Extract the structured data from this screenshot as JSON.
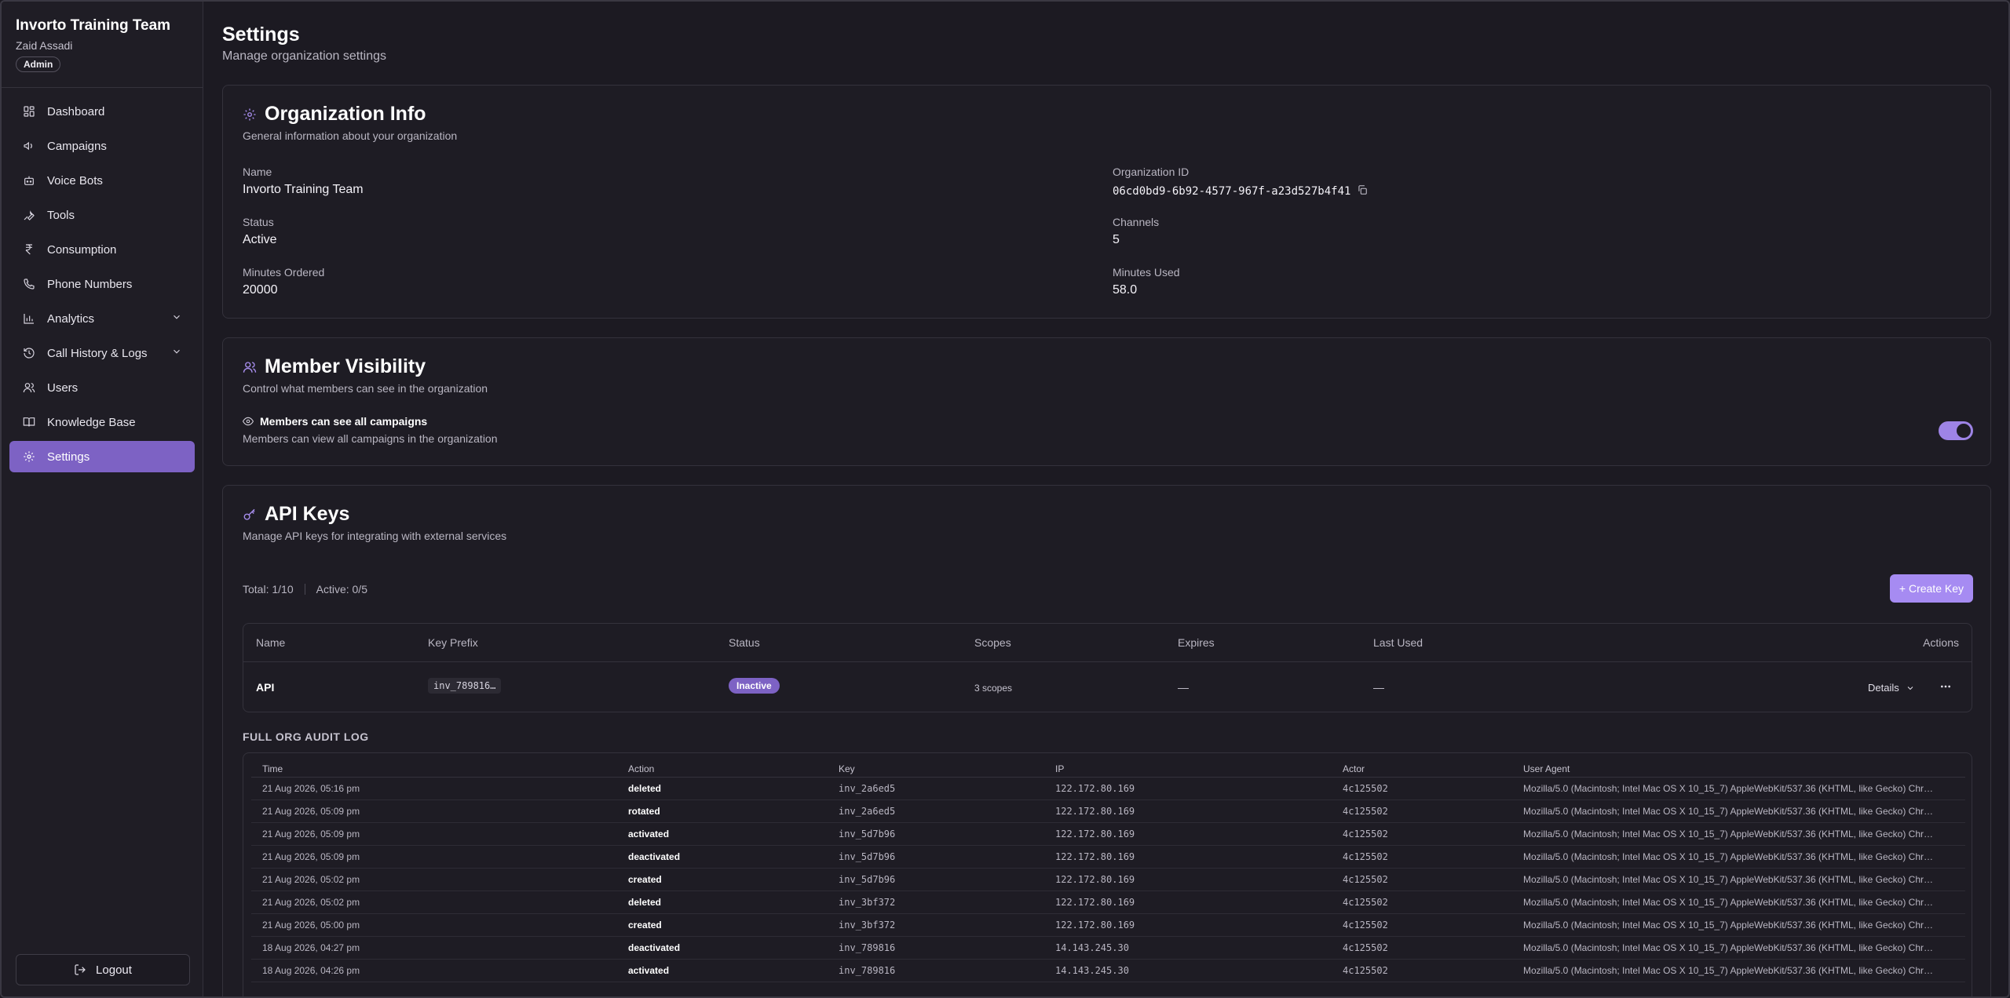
{
  "sidebar": {
    "org_name": "Invorto Training Team",
    "user_name": "Zaid Assadi",
    "role": "Admin",
    "items": [
      {
        "label": "Dashboard",
        "icon": "dashboard-icon"
      },
      {
        "label": "Campaigns",
        "icon": "megaphone-icon"
      },
      {
        "label": "Voice Bots",
        "icon": "bot-icon"
      },
      {
        "label": "Tools",
        "icon": "wrench-icon"
      },
      {
        "label": "Consumption",
        "icon": "rupee-icon"
      },
      {
        "label": "Phone Numbers",
        "icon": "phone-icon"
      },
      {
        "label": "Analytics",
        "icon": "chart-icon"
      },
      {
        "label": "Call History & Logs",
        "icon": "history-icon"
      },
      {
        "label": "Users",
        "icon": "users-icon"
      },
      {
        "label": "Knowledge Base",
        "icon": "book-icon"
      },
      {
        "label": "Settings",
        "icon": "gear-icon"
      }
    ],
    "active": "Settings",
    "logout_label": "Logout"
  },
  "header": {
    "title": "Settings",
    "subtitle": "Manage organization settings"
  },
  "org_info": {
    "title": "Organization Info",
    "subtitle": "General information about your organization",
    "name_label": "Name",
    "name_value": "Invorto Training Team",
    "id_label": "Organization ID",
    "id_value": "06cd0bd9-6b92-4577-967f-a23d527b4f41",
    "status_label": "Status",
    "status_value": "Active",
    "channels_label": "Channels",
    "channels_value": "5",
    "minutes_ordered_label": "Minutes Ordered",
    "minutes_ordered_value": "20000",
    "minutes_used_label": "Minutes Used",
    "minutes_used_value": "58.0"
  },
  "member_visibility": {
    "title": "Member Visibility",
    "subtitle": "Control what members can see in the organization",
    "option_label": "Members can see all campaigns",
    "option_desc": "Members can view all campaigns in the organization",
    "enabled": true
  },
  "api_keys": {
    "title": "API Keys",
    "subtitle": "Manage API keys for integrating with external services",
    "total": "Total: 1/10",
    "active": "Active: 0/5",
    "create_label": "+ Create Key",
    "columns": [
      "Name",
      "Key Prefix",
      "Status",
      "Scopes",
      "Expires",
      "Last Used",
      "Actions"
    ],
    "rows": [
      {
        "name": "API",
        "prefix": "inv_789816…",
        "status": "Inactive",
        "scopes": "3 scopes",
        "expires": "—",
        "last_used": "—",
        "details": "Details"
      }
    ]
  },
  "audit": {
    "title": "FULL ORG AUDIT LOG",
    "columns": [
      "Time",
      "Action",
      "Key",
      "IP",
      "Actor",
      "User Agent"
    ],
    "rows": [
      [
        "21 Aug 2026, 05:16 pm",
        "deleted",
        "inv_2a6ed5",
        "122.172.80.169",
        "4c125502",
        "Mozilla/5.0 (Macintosh; Intel Mac OS X 10_15_7) AppleWebKit/537.36 (KHTML, like Gecko) Chr…"
      ],
      [
        "21 Aug 2026, 05:09 pm",
        "rotated",
        "inv_2a6ed5",
        "122.172.80.169",
        "4c125502",
        "Mozilla/5.0 (Macintosh; Intel Mac OS X 10_15_7) AppleWebKit/537.36 (KHTML, like Gecko) Chr…"
      ],
      [
        "21 Aug 2026, 05:09 pm",
        "activated",
        "inv_5d7b96",
        "122.172.80.169",
        "4c125502",
        "Mozilla/5.0 (Macintosh; Intel Mac OS X 10_15_7) AppleWebKit/537.36 (KHTML, like Gecko) Chr…"
      ],
      [
        "21 Aug 2026, 05:09 pm",
        "deactivated",
        "inv_5d7b96",
        "122.172.80.169",
        "4c125502",
        "Mozilla/5.0 (Macintosh; Intel Mac OS X 10_15_7) AppleWebKit/537.36 (KHTML, like Gecko) Chr…"
      ],
      [
        "21 Aug 2026, 05:02 pm",
        "created",
        "inv_5d7b96",
        "122.172.80.169",
        "4c125502",
        "Mozilla/5.0 (Macintosh; Intel Mac OS X 10_15_7) AppleWebKit/537.36 (KHTML, like Gecko) Chr…"
      ],
      [
        "21 Aug 2026, 05:02 pm",
        "deleted",
        "inv_3bf372",
        "122.172.80.169",
        "4c125502",
        "Mozilla/5.0 (Macintosh; Intel Mac OS X 10_15_7) AppleWebKit/537.36 (KHTML, like Gecko) Chr…"
      ],
      [
        "21 Aug 2026, 05:00 pm",
        "created",
        "inv_3bf372",
        "122.172.80.169",
        "4c125502",
        "Mozilla/5.0 (Macintosh; Intel Mac OS X 10_15_7) AppleWebKit/537.36 (KHTML, like Gecko) Chr…"
      ],
      [
        "18 Aug 2026, 04:27 pm",
        "deactivated",
        "inv_789816",
        "14.143.245.30",
        "4c125502",
        "Mozilla/5.0 (Macintosh; Intel Mac OS X 10_15_7) AppleWebKit/537.36 (KHTML, like Gecko) Chr…"
      ],
      [
        "18 Aug 2026, 04:26 pm",
        "activated",
        "inv_789816",
        "14.143.245.30",
        "4c125502",
        "Mozilla/5.0 (Macintosh; Intel Mac OS X 10_15_7) AppleWebKit/537.36 (KHTML, like Gecko) Chr…"
      ]
    ]
  },
  "colors": {
    "accent": "#7d62c4",
    "accent_light": "#a68bf2",
    "background": "#1c1a22"
  }
}
